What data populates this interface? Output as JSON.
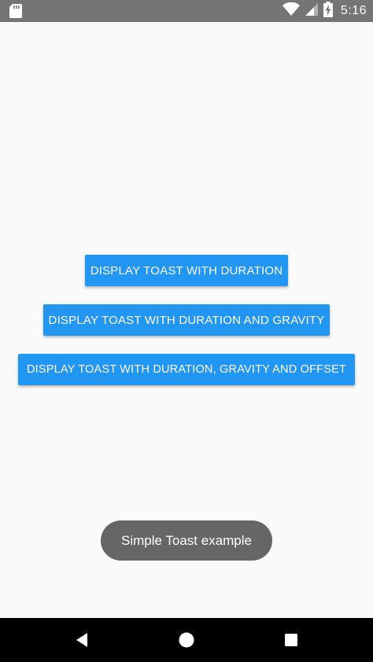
{
  "status_bar": {
    "time": "5:16",
    "icons": [
      "sd-card-icon",
      "wifi-icon",
      "cell-signal-icon",
      "battery-charging-icon"
    ]
  },
  "buttons": {
    "duration_label": "DISPLAY TOAST WITH DURATION",
    "duration_gravity_label": "DISPLAY TOAST WITH DURATION AND GRAVITY",
    "duration_gravity_offset_label": "DISPLAY TOAST WITH DURATION, GRAVITY AND OFFSET"
  },
  "toast": {
    "message": "Simple Toast example"
  },
  "nav_bar": {
    "icons": [
      "back-icon",
      "home-icon",
      "recent-apps-icon"
    ]
  },
  "colors": {
    "status_bar": "#757575",
    "background": "#fafafa",
    "button": "#2196f3",
    "toast": "#666666",
    "nav_bar": "#000000"
  }
}
